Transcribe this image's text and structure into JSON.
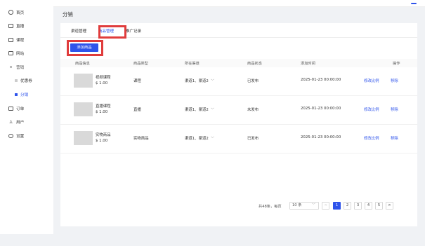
{
  "sidebar": {
    "items": [
      {
        "label": "首页",
        "icon": "home-icon",
        "glyph": "⌂"
      },
      {
        "label": "直播",
        "icon": "live-icon",
        "glyph": "▣"
      },
      {
        "label": "课程",
        "icon": "course-icon",
        "glyph": "▤"
      },
      {
        "label": "网站",
        "icon": "website-icon",
        "glyph": "▭"
      },
      {
        "label": "营销",
        "icon": "marketing-icon",
        "glyph": "▦"
      }
    ],
    "sub_items": [
      {
        "label": "优惠券",
        "active": false
      },
      {
        "label": "分销",
        "active": true
      }
    ],
    "items_after": [
      {
        "label": "订单",
        "icon": "order-icon",
        "glyph": "▧"
      },
      {
        "label": "用户",
        "icon": "user-icon",
        "glyph": "ꆜ"
      },
      {
        "label": "设置",
        "icon": "settings-icon",
        "glyph": "⚙"
      }
    ]
  },
  "main": {
    "title": "分销",
    "tabs": [
      {
        "label": "渠道管理",
        "active": false
      },
      {
        "label": "商品管理",
        "active": true
      },
      {
        "label": "推广记录",
        "active": false
      }
    ],
    "add_button": "添加商品",
    "table": {
      "headers": [
        "商品信息",
        "商品类型",
        "所在渠道",
        "商品状态",
        "添加时间",
        "操作"
      ],
      "rows": [
        {
          "name": "视频课程",
          "price": "$ 1.00",
          "type": "课程",
          "channels": "渠道1、渠道2",
          "status": "已发布",
          "time": "2025-01-23 00:00:00",
          "action1": "修改比例",
          "action2": "移除"
        },
        {
          "name": "直播课程",
          "price": "$ 1.00",
          "type": "直播",
          "channels": "渠道1、渠道2",
          "status": "未发布",
          "time": "2025-01-23 00:00:00",
          "action1": "修改比例",
          "action2": "移除"
        },
        {
          "name": "实物商品",
          "price": "$ 1.00",
          "type": "实物商品",
          "channels": "渠道1、渠道2",
          "status": "已发布",
          "time": "2025-01-23 00:00:00",
          "action1": "修改比例",
          "action2": "移除"
        }
      ]
    },
    "pagination": {
      "total_text": "共48条，每页",
      "page_size": "10 条",
      "pages": [
        "1",
        "2",
        "3",
        "4",
        "5"
      ],
      "current": "1",
      "prev": "<",
      "next": ">"
    }
  },
  "colors": {
    "accent": "#2f54eb",
    "highlight": "#e03c3c"
  }
}
